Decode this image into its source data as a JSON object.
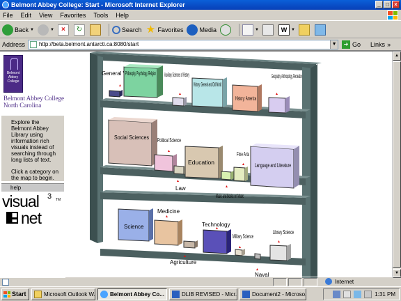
{
  "window": {
    "title": "Belmont Abbey College: Start - Microsoft Internet Explorer"
  },
  "menu": [
    "File",
    "Edit",
    "View",
    "Favorites",
    "Tools",
    "Help"
  ],
  "toolbar": {
    "back": "Back",
    "search": "Search",
    "favorites": "Favorites",
    "media": "Media"
  },
  "address": {
    "label": "Address",
    "url": "http://beta.belmont.antarcti.ca:8080/start",
    "go": "Go",
    "links": "Links"
  },
  "sidebar": {
    "logo_text": "Belmont Abbey College",
    "college_name": "Belmont Abbey College North Carolina",
    "intro_1": "Explore the Belmont Abbey Library using information rich visuals instead of searching through long lists of text.",
    "intro_2": "Click a category on the map to begin.",
    "help": "help",
    "brand_word1": "visual",
    "brand_sup": "3",
    "brand_tm": "TM",
    "brand_word2": "net"
  },
  "shelves": {
    "top": [
      {
        "label": "General Works",
        "color": "#4a4a8a"
      },
      {
        "label": "Philosophy, Psychology, Religion",
        "color": "#7dd3a0"
      },
      {
        "label": "Auxiliary Sciences of History",
        "color": "#e0dcec"
      },
      {
        "label": "History: General and Old World",
        "color": "#b8e6e8"
      },
      {
        "label": "History: America",
        "color": "#f2b49a"
      },
      {
        "label": "Geography, Anthropology, Recreation",
        "color": "#d8ccf0"
      }
    ],
    "middle": [
      {
        "label": "Social Sciences",
        "color": "#d8c0b8"
      },
      {
        "label": "Political Science",
        "color": "#f0c4dc"
      },
      {
        "label": "Law",
        "color": "#d8d4c0"
      },
      {
        "label": "Education",
        "color": "#d8c8b0"
      },
      {
        "label": "Music and Books on Music",
        "color": "#d8f0b0"
      },
      {
        "label": "Fine Arts",
        "color": "#e4ecc0"
      },
      {
        "label": "Language and Literature",
        "color": "#d4cef0"
      }
    ],
    "bottom": [
      {
        "label": "Science",
        "color": "#9ab0e8"
      },
      {
        "label": "Medicine",
        "color": "#e8c4a0"
      },
      {
        "label": "Agriculture",
        "color": "#c8b8a8"
      },
      {
        "label": "Technology",
        "color": "#5a50b8"
      },
      {
        "label": "Military Science",
        "color": "#e8e0d0"
      },
      {
        "label": "Naval",
        "color": "#bcbcbc"
      },
      {
        "label": "Library Science",
        "color": "#e4e4e4"
      }
    ]
  },
  "status": {
    "zone": "Internet"
  },
  "taskbar": {
    "start": "Start",
    "tasks": [
      "Microsoft Outlook W...",
      "Belmont Abbey Co...",
      "DLIB REVISED - Micr...",
      "Document2 - Microso..."
    ],
    "clock": "1:31 PM"
  }
}
